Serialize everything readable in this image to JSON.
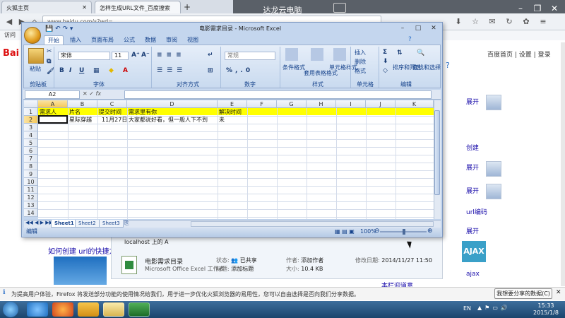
{
  "remote": {
    "title": "达龙云电脑"
  },
  "firefox": {
    "tabs": [
      {
        "label": "火狐主页"
      },
      {
        "label": "怎样生成URL文件_百度搜索"
      }
    ],
    "url": "www.baidu.com/s?wd=...",
    "bookmark": "访问",
    "notification": "为提高用户体验，Firefox 将发送部分功能的使用情况给我们，用于进一步优化火狐浏览器的易用性，您可以自由选择是否向我们分享数据。",
    "notification_button": "我想要分享的数据(C)"
  },
  "baidu": {
    "logo": "Bai",
    "nav": [
      "百度首页",
      "设置",
      "登录"
    ],
    "results": [
      "如何创建 url的快捷方式"
    ],
    "right_links": [
      "展开",
      "创建",
      "展开",
      "展开",
      "url编码",
      "展开",
      "ajax"
    ],
    "footer_link": "本栏迎道意",
    "ajax_label": "AJAX"
  },
  "explorer": {
    "location": "localhost 上的 A",
    "file_name": "电影需求目录",
    "file_type": "Microsoft Office Excel 工作表",
    "status_label": "状态:",
    "status_value": "已共享",
    "tags_label": "标题:",
    "tags_value": "添加标题",
    "author_label": "作者:",
    "author_value": "添加作者",
    "size_label": "大小:",
    "size_value": "10.4 KB",
    "modified_label": "修改日期:",
    "modified_value": "2014/11/27 11:50"
  },
  "excel": {
    "title": "电影需求目录 - Microsoft Excel",
    "ribbon_tabs": [
      "开始",
      "插入",
      "页面布局",
      "公式",
      "数据",
      "审阅",
      "视图"
    ],
    "groups": [
      "剪贴板",
      "字体",
      "对齐方式",
      "数字",
      "样式",
      "单元格",
      "编辑"
    ],
    "paste_label": "粘贴",
    "font_name": "宋体",
    "font_size": "11",
    "number_format": "常规",
    "style_buttons": [
      "条件格式",
      "套用表格格式",
      "单元格样式"
    ],
    "cell_buttons": [
      "插入",
      "删除",
      "格式"
    ],
    "edit_buttons": [
      "排序和筛选",
      "查找和选择"
    ],
    "name_box": "A2",
    "fx_label": "fx",
    "columns": [
      "A",
      "B",
      "C",
      "D",
      "E",
      "F",
      "G",
      "H",
      "I",
      "J",
      "K"
    ],
    "rows": [
      "1",
      "2",
      "3",
      "4",
      "5",
      "6",
      "7",
      "8",
      "9",
      "10",
      "11",
      "12",
      "13",
      "14"
    ],
    "row1": [
      "需求人",
      "片名",
      "提交时间",
      "需求里有你",
      "解决时间"
    ],
    "row2": [
      "",
      "星际穿越",
      "11月27日",
      "大家都说好看，但一般人下不到",
      "未"
    ],
    "sheets": [
      "Sheet1",
      "Sheet2",
      "Sheet3"
    ],
    "status": "编辑",
    "zoom": "100%"
  },
  "taskbar": {
    "time": "15:33",
    "date": "2015/1/8",
    "lang": "EN"
  }
}
